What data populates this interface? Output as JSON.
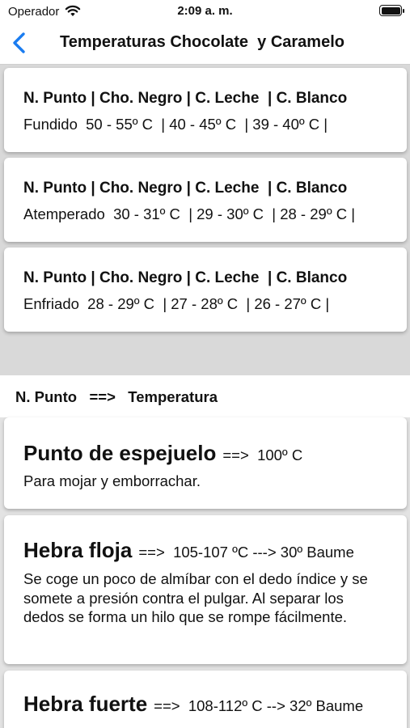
{
  "status_bar": {
    "carrier": "Operador",
    "time": "2:09 a. m."
  },
  "nav": {
    "title": "Temperaturas Chocolate  y Caramelo"
  },
  "chocolate_cards": [
    {
      "header": "N. Punto | Cho. Negro | C. Leche  | C. Blanco",
      "row": "Fundido  50 - 55º C  | 40 - 45º C  | 39 - 40º C |"
    },
    {
      "header": "N. Punto | Cho. Negro | C. Leche  | C. Blanco",
      "row": "Atemperado  30 - 31º C  | 29 - 30º C  | 28 - 29º C |"
    },
    {
      "header": "N. Punto | Cho. Negro | C. Leche  | C. Blanco",
      "row": "Enfriado  28 - 29º C  | 27 - 28º C  | 26 - 27º C |"
    }
  ],
  "section": {
    "label": "N. Punto   ==>   Temperatura"
  },
  "caramel_points": [
    {
      "name": "Punto de espejuelo",
      "temp": "==>  100º C",
      "description": "Para mojar y emborrachar."
    },
    {
      "name": "Hebra floja",
      "temp": "==>  105-107 ºC ---> 30º Baume",
      "description": "Se coge un poco de almíbar con el dedo índice y se somete a presión contra el pulgar.  Al separar los dedos se forma un hilo que se rompe fácilmente."
    },
    {
      "name": "Hebra fuerte",
      "temp": "==>  108-112º C --> 32º Baume",
      "description": ""
    }
  ]
}
